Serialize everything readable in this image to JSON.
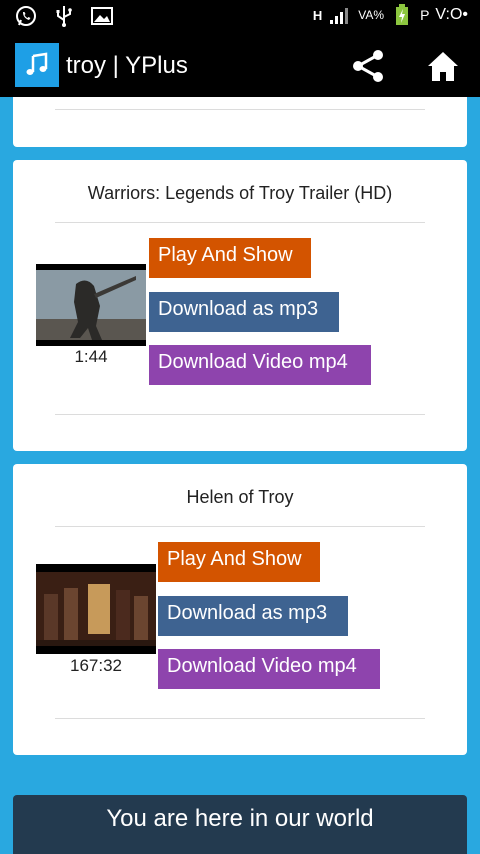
{
  "status_bar": {
    "network": "H",
    "battery_label": "VA%",
    "carrier": "P",
    "time": "V:O•"
  },
  "app_bar": {
    "title": "troy | YPlus"
  },
  "results": [
    {
      "title": "Warriors: Legends of Troy Trailer (HD)",
      "duration": "1:44",
      "buttons": {
        "play": "Play And Show",
        "mp3": "Download as mp3",
        "mp4": "Download Video mp4"
      }
    },
    {
      "title": "Helen of Troy",
      "duration": "167:32",
      "buttons": {
        "play": "Play And Show",
        "mp3": "Download as mp3",
        "mp4": "Download Video mp4"
      }
    }
  ],
  "footer": {
    "banner_text": "You are here in our world"
  },
  "colors": {
    "background": "#29a8e0",
    "play_button": "#d35400",
    "mp3_button": "#3e6391",
    "mp4_button": "#8e44ad",
    "banner": "#233a4f"
  }
}
